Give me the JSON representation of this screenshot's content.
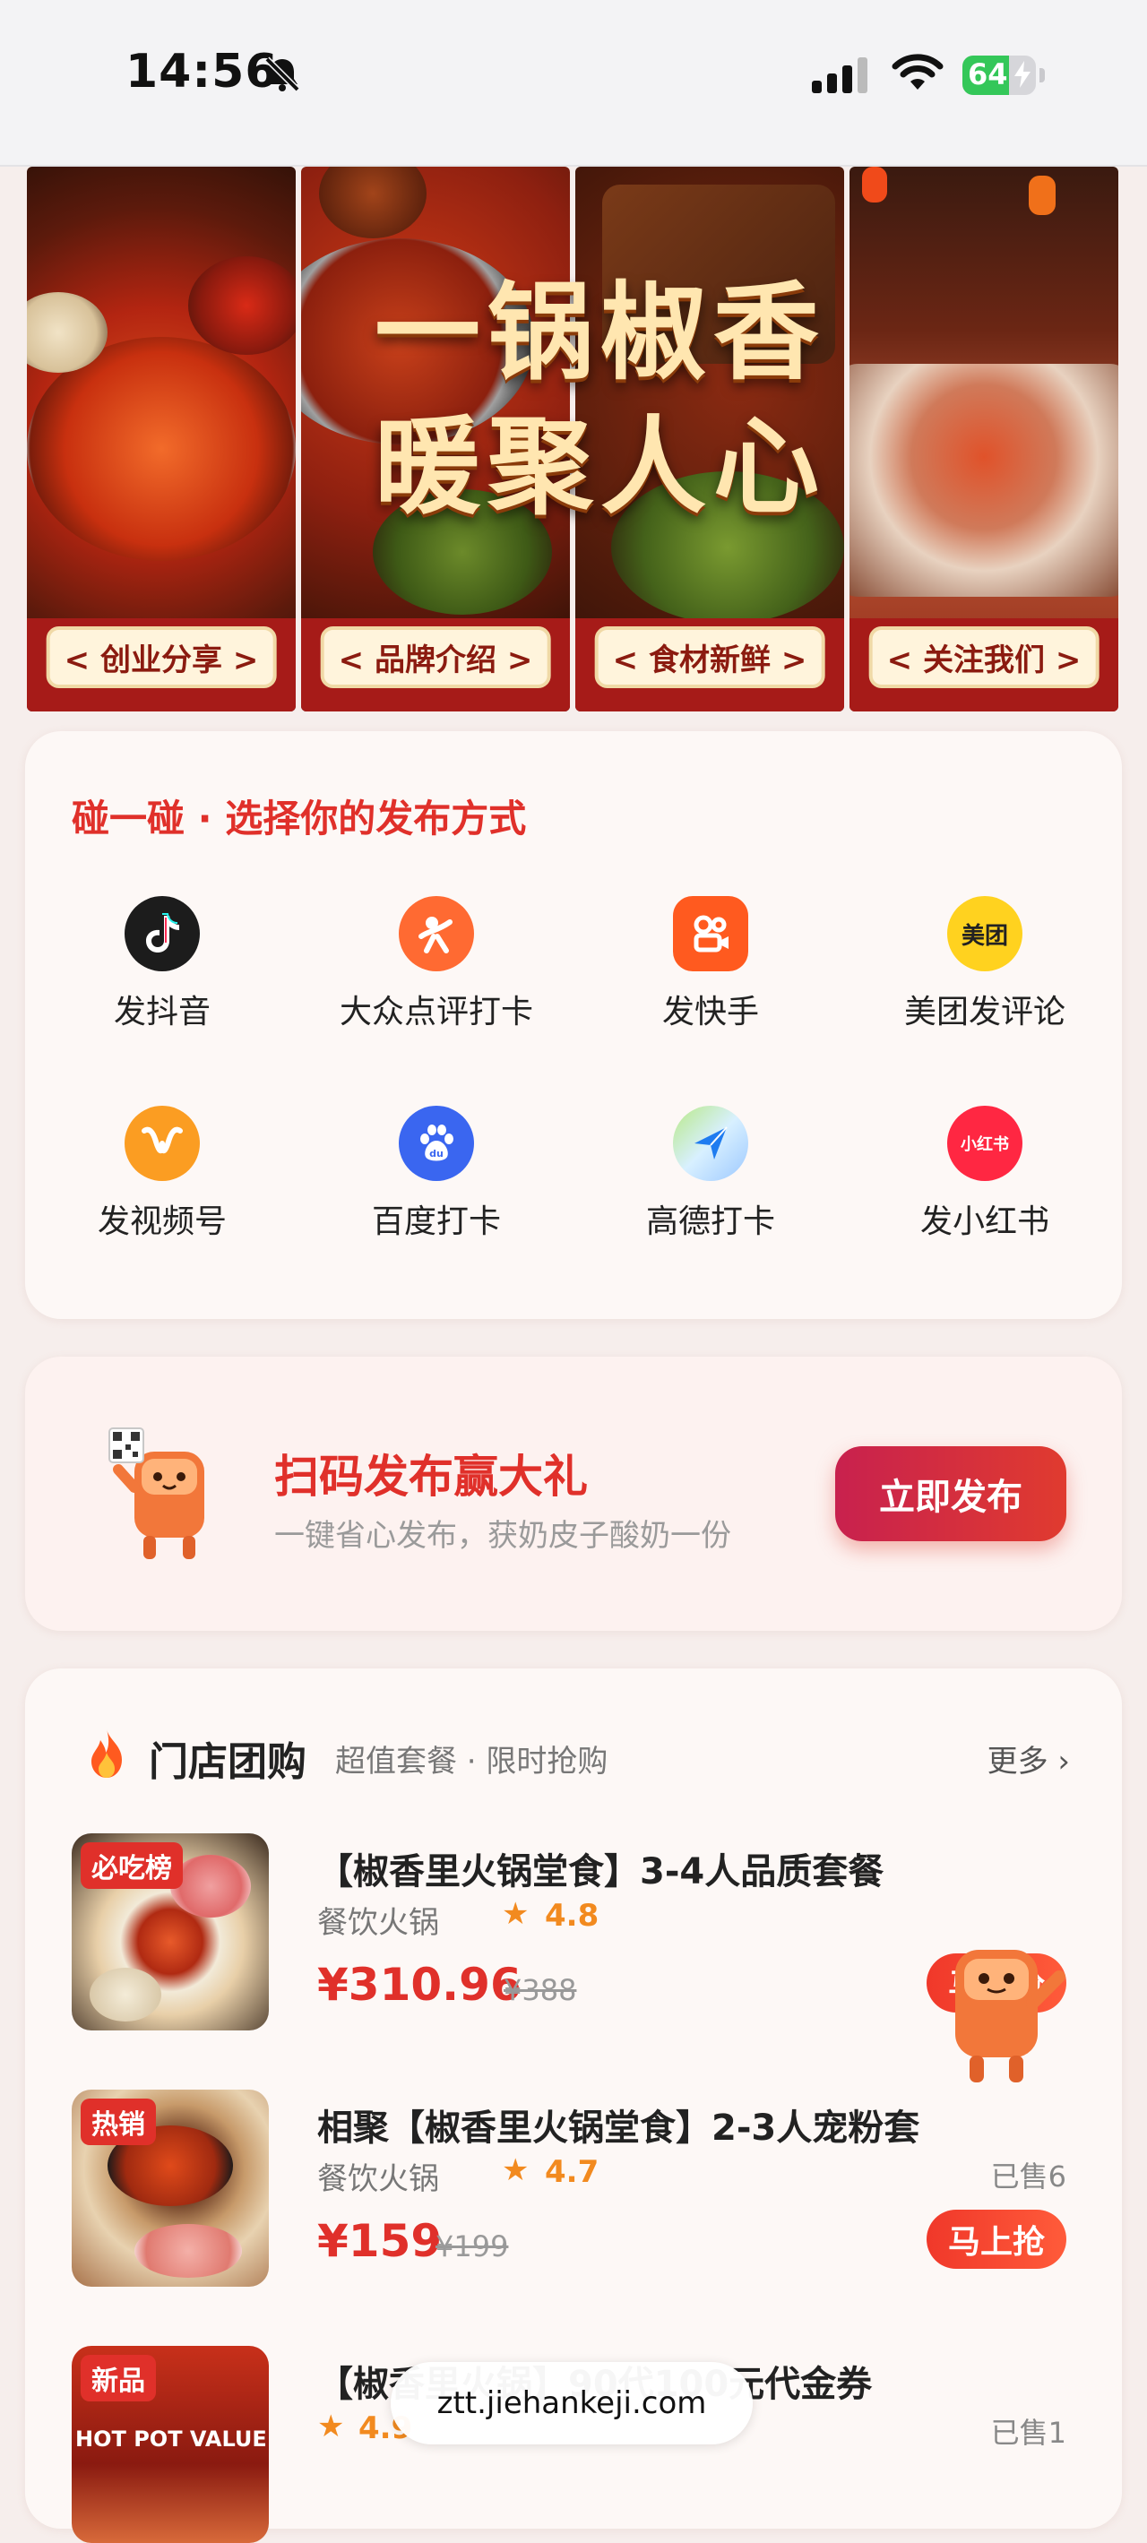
{
  "status": {
    "time": "14:56",
    "battery": "64",
    "battery_level": 0.64
  },
  "banner": {
    "slogan_line1": "一锅椒香",
    "slogan_line2": "暖聚人心",
    "panels": [
      {
        "label": "< 创业分享 >"
      },
      {
        "label": "< 品牌介绍 >"
      },
      {
        "label": "< 食材新鲜 >"
      },
      {
        "label": "< 关注我们 >"
      }
    ]
  },
  "publish": {
    "title": "碰一碰 · 选择你的发布方式",
    "items": [
      {
        "label": "发抖音",
        "icon": "douyin-icon",
        "color": "#1c1c1c"
      },
      {
        "label": "大众点评打卡",
        "icon": "dianping-icon",
        "color": "#ff6a32"
      },
      {
        "label": "发快手",
        "icon": "kuaishou-icon",
        "color": "#ff5a1f"
      },
      {
        "label": "美团发评论",
        "icon": "meituan-icon",
        "color": "#ffd21f",
        "badge": "美团"
      },
      {
        "label": "发视频号",
        "icon": "channels-icon",
        "color": "#fb9d22"
      },
      {
        "label": "百度打卡",
        "icon": "baidu-icon",
        "color": "#3a66f0"
      },
      {
        "label": "高德打卡",
        "icon": "amap-icon",
        "color": "#4aa3ff"
      },
      {
        "label": "发小红书",
        "icon": "xiaohongshu-icon",
        "color": "#ff2742",
        "badge": "小红书"
      }
    ]
  },
  "scan": {
    "title": "扫码发布赢大礼",
    "subtitle": "一键省心发布，获奶皮子酸奶一份",
    "button": "立即发布"
  },
  "group": {
    "title": "门店团购",
    "subtitle": "超值套餐 · 限时抢购",
    "more": "更多 ›",
    "deals": [
      {
        "tag": "必吃榜",
        "name": "【椒香里火锅堂食】3-4人品质套餐",
        "category": "餐饮火锅",
        "star": "★",
        "rating": "4.8",
        "price": "¥310.96",
        "original": "¥388",
        "sold": "",
        "button": "马上抢"
      },
      {
        "tag": "热销",
        "name": "相聚【椒香里火锅堂食】2-3人宠粉套",
        "category": "餐饮火锅",
        "star": "★",
        "rating": "4.7",
        "price": "¥159",
        "original": "¥199",
        "sold": "已售6",
        "button": "马上抢"
      },
      {
        "tag": "新品",
        "name": "【椒香里火锅】90代100元代金券",
        "category": "",
        "star": "★",
        "rating": "4.9",
        "price": "",
        "original": "",
        "sold": "已售1",
        "button": ""
      }
    ],
    "thumb3_text": "HOT POT VALUE"
  },
  "url": "ztt.jiehankeji.com"
}
